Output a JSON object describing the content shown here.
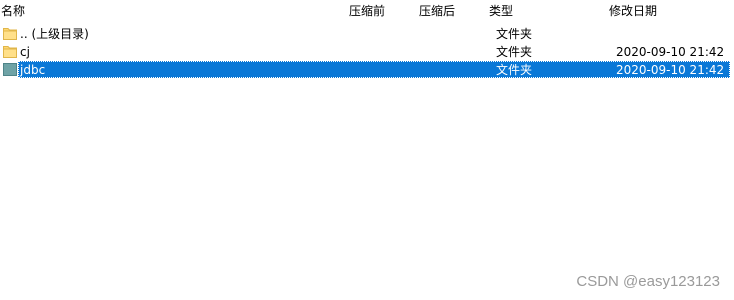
{
  "columns": {
    "name": "名称",
    "packed": "压缩前",
    "size": "压缩后",
    "type": "类型",
    "modified": "修改日期"
  },
  "rows": [
    {
      "name": ".. (上级目录)",
      "type": "文件夹",
      "modified": "",
      "selected": false,
      "icon": "folder-icon"
    },
    {
      "name": "cj",
      "type": "文件夹",
      "modified": "2020-09-10 21:42",
      "selected": false,
      "icon": "folder-icon"
    },
    {
      "name": "jdbc",
      "type": "文件夹",
      "modified": "2020-09-10 21:42",
      "selected": true,
      "icon": "folder-icon"
    }
  ],
  "watermark": "CSDN @easy123123",
  "colors": {
    "selection": "#0a78d7",
    "folder": "#ffd770",
    "folder_selected": "#6fa3a6"
  }
}
